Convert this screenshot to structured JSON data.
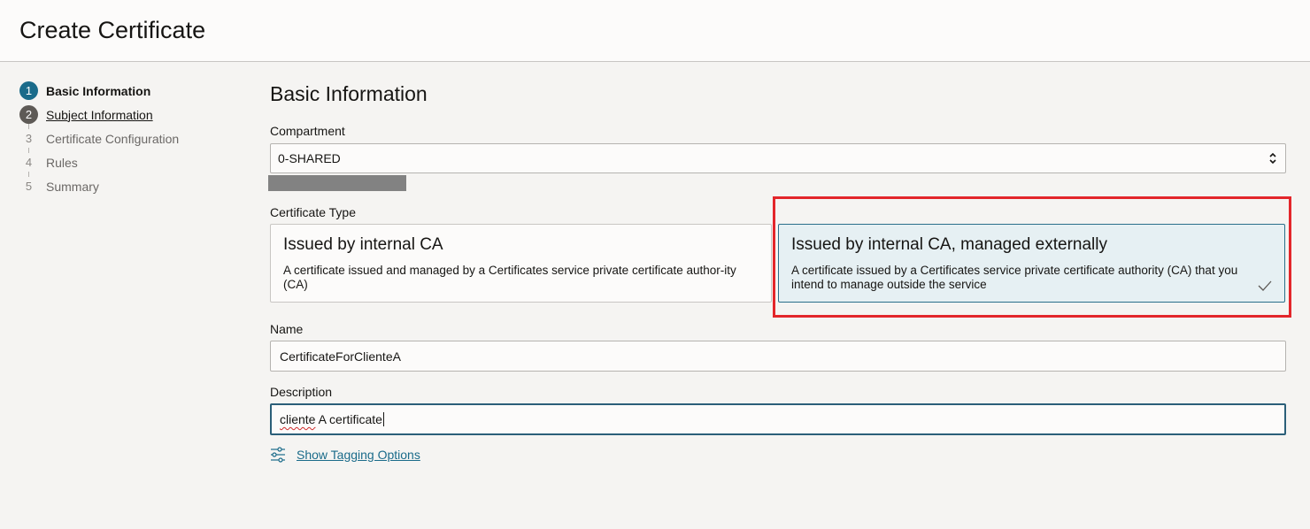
{
  "header": {
    "title": "Create Certificate"
  },
  "steps": [
    {
      "number": "1",
      "label": "Basic Information",
      "state": "active"
    },
    {
      "number": "2",
      "label": "Subject Information",
      "state": "visited"
    },
    {
      "number": "3",
      "label": "Certificate Configuration",
      "state": "pending"
    },
    {
      "number": "4",
      "label": "Rules",
      "state": "pending"
    },
    {
      "number": "5",
      "label": "Summary",
      "state": "pending"
    }
  ],
  "main": {
    "section_title": "Basic Information",
    "compartment": {
      "label": "Compartment",
      "value": "0-SHARED"
    },
    "certificate_type": {
      "label": "Certificate Type",
      "options": [
        {
          "title": "Issued by internal CA",
          "description": "A certificate issued and managed by a Certificates service private certificate author-ity (CA)",
          "selected": false
        },
        {
          "title": "Issued by internal CA, managed externally",
          "description": "A certificate issued by a Certificates service private certificate authority (CA) that you intend to manage outside the service",
          "selected": true
        }
      ]
    },
    "name": {
      "label": "Name",
      "value": "CertificateForClienteA"
    },
    "description": {
      "label": "Description",
      "value_misspelled": "cliente",
      "value_rest": " A certificate"
    },
    "tagging_link": "Show Tagging Options"
  },
  "colors": {
    "accent": "#1a6b8a",
    "selected_bg": "#e6f0f3",
    "highlight": "#e3262b"
  }
}
